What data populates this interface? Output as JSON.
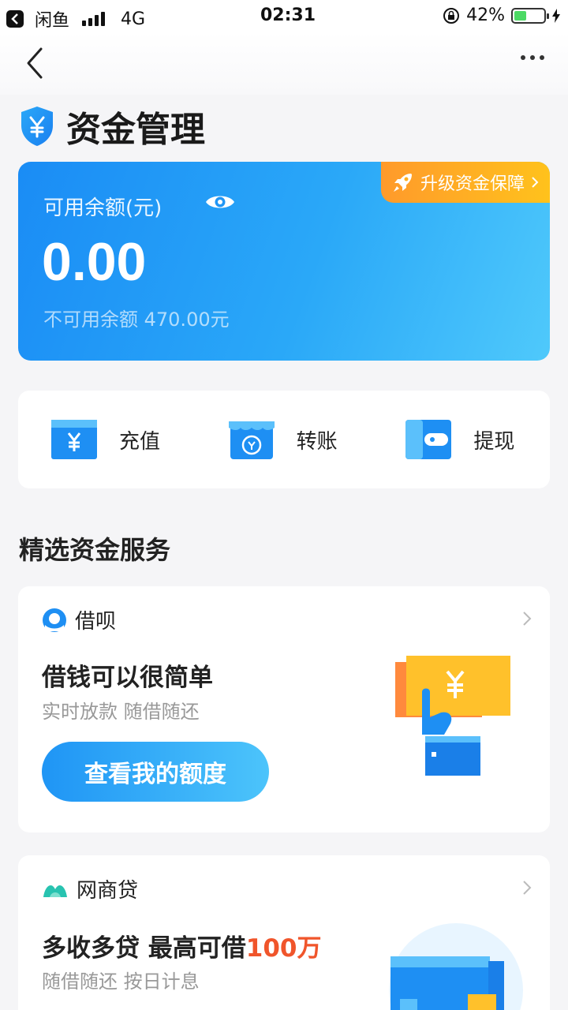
{
  "status_bar": {
    "back_app": "闲鱼",
    "network": "4G",
    "time": "02:31",
    "battery": "42%",
    "battery_level": 0.42
  },
  "page": {
    "title": "资金管理"
  },
  "balance": {
    "label": "可用余额(元)",
    "amount": "0.00",
    "unavailable": "不可用余额 470.00元",
    "upgrade_label": "升级资金保障"
  },
  "actions": [
    {
      "label": "充值",
      "icon": "recharge-icon"
    },
    {
      "label": "转账",
      "icon": "transfer-icon"
    },
    {
      "label": "提现",
      "icon": "withdraw-icon"
    }
  ],
  "section": {
    "title": "精选资金服务"
  },
  "services": [
    {
      "brand": "借呗",
      "title": "借钱可以很简单",
      "desc": "实时放款 随借随还",
      "button": "查看我的额度"
    },
    {
      "brand": "网商贷",
      "title_prefix": "多收多贷 最高可借",
      "title_highlight": "100万",
      "desc": "随借随还 按日计息"
    }
  ],
  "colors": {
    "accent_blue": "#1a8cf5",
    "highlight_red": "#f0552b",
    "badge_orange": "#ff9a2b"
  }
}
